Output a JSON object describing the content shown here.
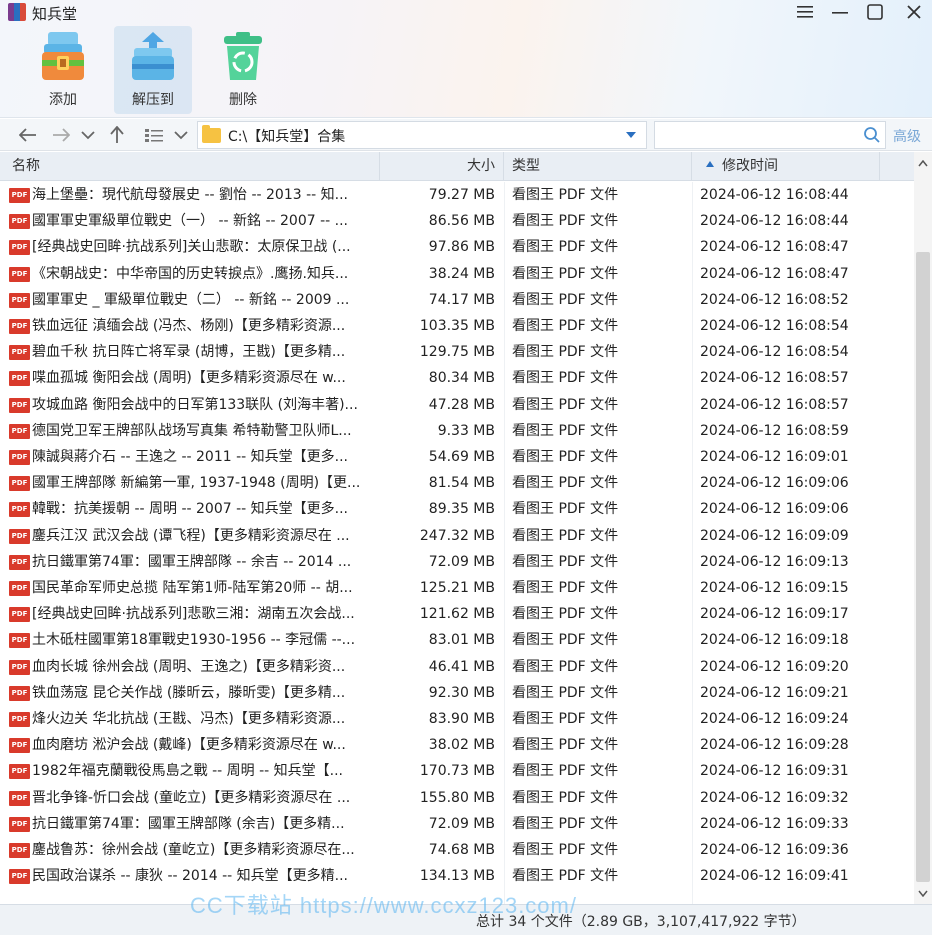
{
  "window": {
    "title": "知兵堂"
  },
  "toolbar": {
    "add_label": "添加",
    "extract_label": "解压到",
    "delete_label": "删除"
  },
  "nav": {
    "path": "C:\\【知兵堂】合集",
    "search_placeholder": "",
    "advanced_label": "高级"
  },
  "columns": {
    "name": "名称",
    "size": "大小",
    "type": "类型",
    "modified": "修改时间"
  },
  "files": [
    {
      "name": "海上堡壘：現代航母發展史 -- 劉怡 -- 2013 -- 知...",
      "size": "79.27 MB",
      "type": "看图王 PDF 文件",
      "time": "2024-06-12 16:08:44"
    },
    {
      "name": "國軍軍史軍級單位戰史（一） -- 新銘 -- 2007 -- ...",
      "size": "86.56 MB",
      "type": "看图王 PDF 文件",
      "time": "2024-06-12 16:08:44"
    },
    {
      "name": "[经典战史回眸·抗战系列]关山悲歌：太原保卫战 (...",
      "size": "97.86 MB",
      "type": "看图王 PDF 文件",
      "time": "2024-06-12 16:08:47"
    },
    {
      "name": "《宋朝战史：中华帝国的历史转捩点》.鹰扬.知兵...",
      "size": "38.24 MB",
      "type": "看图王 PDF 文件",
      "time": "2024-06-12 16:08:47"
    },
    {
      "name": "國軍軍史 _ 軍級單位戰史（二） -- 新銘 -- 2009 ...",
      "size": "74.17 MB",
      "type": "看图王 PDF 文件",
      "time": "2024-06-12 16:08:52"
    },
    {
      "name": "铁血远征 滇缅会战 (冯杰、杨刚)【更多精彩资源...",
      "size": "103.35 MB",
      "type": "看图王 PDF 文件",
      "time": "2024-06-12 16:08:54"
    },
    {
      "name": "碧血千秋 抗日阵亡将军录 (胡博，王戡)【更多精...",
      "size": "129.75 MB",
      "type": "看图王 PDF 文件",
      "time": "2024-06-12 16:08:54"
    },
    {
      "name": "喋血孤城 衡阳会战 (周明)【更多精彩资源尽在 w...",
      "size": "80.34 MB",
      "type": "看图王 PDF 文件",
      "time": "2024-06-12 16:08:57"
    },
    {
      "name": "攻城血路 衡阳会战中的日军第133联队 (刘海丰著)...",
      "size": "47.28 MB",
      "type": "看图王 PDF 文件",
      "time": "2024-06-12 16:08:57"
    },
    {
      "name": "德国党卫军王牌部队战场写真集 希特勒警卫队师L...",
      "size": "9.33 MB",
      "type": "看图王 PDF 文件",
      "time": "2024-06-12 16:08:59"
    },
    {
      "name": "陳誠與蔣介石 -- 王逸之 -- 2011 -- 知兵堂【更多...",
      "size": "54.69 MB",
      "type": "看图王 PDF 文件",
      "time": "2024-06-12 16:09:01"
    },
    {
      "name": "國軍王牌部隊 新編第一軍, 1937-1948 (周明)【更...",
      "size": "81.54 MB",
      "type": "看图王 PDF 文件",
      "time": "2024-06-12 16:09:06"
    },
    {
      "name": "韓戰：抗美援朝 -- 周明 -- 2007 -- 知兵堂【更多...",
      "size": "89.35 MB",
      "type": "看图王 PDF 文件",
      "time": "2024-06-12 16:09:06"
    },
    {
      "name": "鏖兵江汉 武汉会战 (谭飞程)【更多精彩资源尽在 ...",
      "size": "247.32 MB",
      "type": "看图王 PDF 文件",
      "time": "2024-06-12 16:09:09"
    },
    {
      "name": "抗日鐵軍第74軍：國軍王牌部隊 -- 余吉 -- 2014 ...",
      "size": "72.09 MB",
      "type": "看图王 PDF 文件",
      "time": "2024-06-12 16:09:13"
    },
    {
      "name": "国民革命军师史总揽 陆军第1师-陆军第20师 -- 胡...",
      "size": "125.21 MB",
      "type": "看图王 PDF 文件",
      "time": "2024-06-12 16:09:15"
    },
    {
      "name": "[经典战史回眸·抗战系列]悲歌三湘：湖南五次会战...",
      "size": "121.62 MB",
      "type": "看图王 PDF 文件",
      "time": "2024-06-12 16:09:17"
    },
    {
      "name": "土木砥柱國軍第18軍戰史1930-1956 -- 李冠儒 --...",
      "size": "83.01 MB",
      "type": "看图王 PDF 文件",
      "time": "2024-06-12 16:09:18"
    },
    {
      "name": "血肉长城 徐州会战 (周明、王逸之)【更多精彩资...",
      "size": "46.41 MB",
      "type": "看图王 PDF 文件",
      "time": "2024-06-12 16:09:20"
    },
    {
      "name": "铁血荡寇 昆仑关作战 (滕昕云，滕昕雯)【更多精...",
      "size": "92.30 MB",
      "type": "看图王 PDF 文件",
      "time": "2024-06-12 16:09:21"
    },
    {
      "name": "烽火边关 华北抗战 (王戡、冯杰)【更多精彩资源...",
      "size": "83.90 MB",
      "type": "看图王 PDF 文件",
      "time": "2024-06-12 16:09:24"
    },
    {
      "name": "血肉磨坊 淞沪会战 (戴峰)【更多精彩资源尽在 w...",
      "size": "38.02 MB",
      "type": "看图王 PDF 文件",
      "time": "2024-06-12 16:09:28"
    },
    {
      "name": "1982年福克蘭戰役馬島之戰 -- 周明 -- 知兵堂【...",
      "size": "170.73 MB",
      "type": "看图王 PDF 文件",
      "time": "2024-06-12 16:09:31"
    },
    {
      "name": "晋北争锋-忻口会战 (童屹立)【更多精彩资源尽在 ...",
      "size": "155.80 MB",
      "type": "看图王 PDF 文件",
      "time": "2024-06-12 16:09:32"
    },
    {
      "name": "抗日鐵軍第74軍：國軍王牌部隊 (余吉)【更多精...",
      "size": "72.09 MB",
      "type": "看图王 PDF 文件",
      "time": "2024-06-12 16:09:33"
    },
    {
      "name": "鏖战鲁苏：徐州会战 (童屹立)【更多精彩资源尽在...",
      "size": "74.68 MB",
      "type": "看图王 PDF 文件",
      "time": "2024-06-12 16:09:36"
    },
    {
      "name": "民国政治谋杀 -- 康狄 -- 2014 -- 知兵堂【更多精...",
      "size": "134.13 MB",
      "type": "看图王 PDF 文件",
      "time": "2024-06-12 16:09:41"
    }
  ],
  "status": {
    "summary": "总计 34 个文件（2.89 GB，3,107,417,922 字节）"
  },
  "watermark": "CC下载站 https://www.ccxz123.com/"
}
